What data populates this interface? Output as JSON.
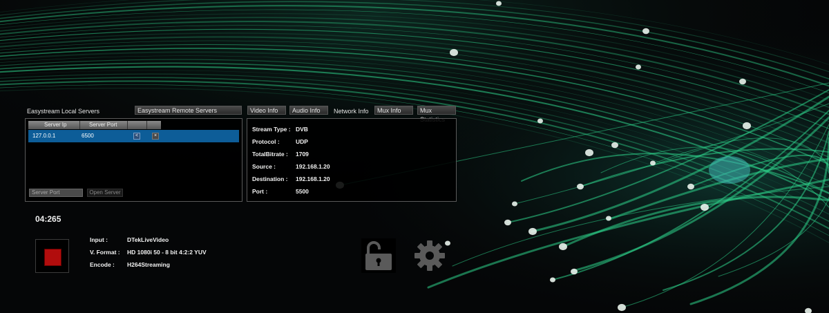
{
  "tabs": {
    "local_servers": "Easystream Local Servers",
    "remote_servers": "Easystream Remote Servers",
    "video_info": "Video Info",
    "audio_info": "Audio Info",
    "network_info": "Network Info",
    "mux_info": "Mux Info",
    "mux_statistics": "Mux Statistics"
  },
  "servers": {
    "columns": [
      "Server Ip",
      "Server Port"
    ],
    "rows": [
      {
        "ip": "127.0.0.1",
        "port": "6500",
        "connect_icon": "arrow-left-icon",
        "delete_icon": "close-icon"
      }
    ],
    "port_placeholder": "Server Port",
    "open_button": "Open Server"
  },
  "network": {
    "stream_type": {
      "label": "Stream Type :",
      "value": "DVB"
    },
    "protocol": {
      "label": "Protocol :",
      "value": "UDP"
    },
    "total_bitrate": {
      "label": "TotalBitrate :",
      "value": "1709"
    },
    "source": {
      "label": "Source :",
      "value": "192.168.1.20"
    },
    "destination": {
      "label": "Destination :",
      "value": "192.168.1.20"
    },
    "port": {
      "label": "Port :",
      "value": "5500"
    }
  },
  "timer": "04:265",
  "source_info": {
    "input": {
      "label": "Input :",
      "value": "DTekLiveVideo"
    },
    "format": {
      "label": "V. Format :",
      "value": "HD 1080i 50 - 8 bit 4:2:2 YUV"
    },
    "encode": {
      "label": "Encode :",
      "value": "H264Streaming"
    }
  },
  "icons": {
    "stop": "stop-icon",
    "lock": "unlock-icon",
    "settings": "gear-icon"
  },
  "colors": {
    "accent_green": "#2ed18a",
    "selection_blue": "#0d5d98",
    "stop_red": "#b10d0d",
    "icon_gray": "#5a5a5a"
  }
}
